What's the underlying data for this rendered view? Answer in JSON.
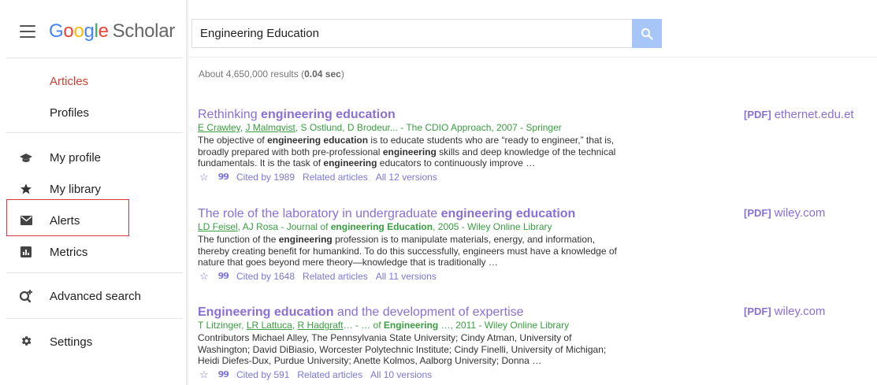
{
  "app": {
    "logo_google": [
      "G",
      "o",
      "o",
      "g",
      "l",
      "e"
    ],
    "logo_scholar": "Scholar"
  },
  "search": {
    "value": "Engineering Education"
  },
  "sidebar": {
    "top_items": [
      {
        "label": "Articles",
        "active": true
      },
      {
        "label": "Profiles",
        "active": false
      }
    ],
    "items": [
      {
        "label": "My profile",
        "icon": "graduation-cap-icon"
      },
      {
        "label": "My library",
        "icon": "star-icon"
      },
      {
        "label": "Alerts",
        "icon": "envelope-icon"
      },
      {
        "label": "Metrics",
        "icon": "metrics-icon"
      },
      {
        "label": "Advanced search",
        "icon": "search-plus-icon"
      },
      {
        "label": "Settings",
        "icon": "gear-icon"
      }
    ]
  },
  "results_summary": {
    "prefix": "About 4,650,000 results (",
    "time": "0.04 sec",
    "suffix": ")"
  },
  "results": [
    {
      "title_parts": [
        {
          "t": "Rethinking ",
          "b": false
        },
        {
          "t": "engineering education",
          "b": true
        }
      ],
      "authors_parts": [
        {
          "t": "E Crawley",
          "u": true
        },
        {
          "t": ", ",
          "u": false
        },
        {
          "t": "J Malmqvist",
          "u": true
        },
        {
          "t": ", S Ostlund, D Brodeur... - The CDIO Approach, 2007 - Springer",
          "u": false
        }
      ],
      "snippet_parts": [
        {
          "t": "The objective of ",
          "b": false
        },
        {
          "t": "engineering education",
          "b": true
        },
        {
          "t": " is to educate students who are “ready to engineer,” that is, broadly prepared with both pre-professional ",
          "b": false
        },
        {
          "t": "engineering",
          "b": true
        },
        {
          "t": " skills and deep knowledge of the technical fundamentals. It is the task of ",
          "b": false
        },
        {
          "t": "engineering",
          "b": true
        },
        {
          "t": " educators to continuously improve …",
          "b": false
        }
      ],
      "cited_by": "Cited by 1989",
      "related": "Related articles",
      "versions": "All 12 versions",
      "pdf_tag": "[PDF]",
      "pdf_source": "ethernet.edu.et"
    },
    {
      "title_parts": [
        {
          "t": "The role of the laboratory in undergraduate ",
          "b": false
        },
        {
          "t": "engineering education",
          "b": true
        }
      ],
      "authors_parts": [
        {
          "t": "LD Feisel",
          "u": true
        },
        {
          "t": ", AJ Rosa - Journal of ",
          "u": false
        },
        {
          "t": "engineering Education",
          "u": false,
          "b": true
        },
        {
          "t": ", 2005 - Wiley Online Library",
          "u": false
        }
      ],
      "snippet_parts": [
        {
          "t": "The function of the ",
          "b": false
        },
        {
          "t": "engineering",
          "b": true
        },
        {
          "t": " profession is to manipulate materials, energy, and information, thereby creating benefit for humankind. To do this successfully, engineers must have a knowledge of nature that goes beyond mere theory—knowledge that is traditionally …",
          "b": false
        }
      ],
      "cited_by": "Cited by 1648",
      "related": "Related articles",
      "versions": "All 11 versions",
      "pdf_tag": "[PDF]",
      "pdf_source": "wiley.com"
    },
    {
      "title_parts": [
        {
          "t": "Engineering education",
          "b": true
        },
        {
          "t": " and the development of expertise",
          "b": false
        }
      ],
      "authors_parts": [
        {
          "t": "T Litzinger, ",
          "u": false
        },
        {
          "t": "LR Lattuca",
          "u": true
        },
        {
          "t": ", ",
          "u": false
        },
        {
          "t": "R Hadgraft",
          "u": true
        },
        {
          "t": "… - … of ",
          "u": false
        },
        {
          "t": "Engineering",
          "u": false,
          "b": true
        },
        {
          "t": " …, 2011 - Wiley Online Library",
          "u": false
        }
      ],
      "snippet_parts": [
        {
          "t": "Contributors Michael Alley, The Pennsylvania State University; Cindy Atman, University of Washington; David DiBiasio, Worcester Polytechnic Institute; Cindy Finelli, University of Michigan; Heidi Diefes-Dux, Purdue University; Anette Kolmos, Aalborg University; Donna …",
          "b": false
        }
      ],
      "cited_by": "Cited by 591",
      "related": "Related articles",
      "versions": "All 10 versions",
      "pdf_tag": "[PDF]",
      "pdf_source": "wiley.com"
    }
  ],
  "colors": {
    "accent_red": "#d23f31",
    "link_purple": "#8a6fd6",
    "author_green": "#389e3f",
    "search_button": "#a5c6f7",
    "highlight_box": "#d9393e"
  }
}
